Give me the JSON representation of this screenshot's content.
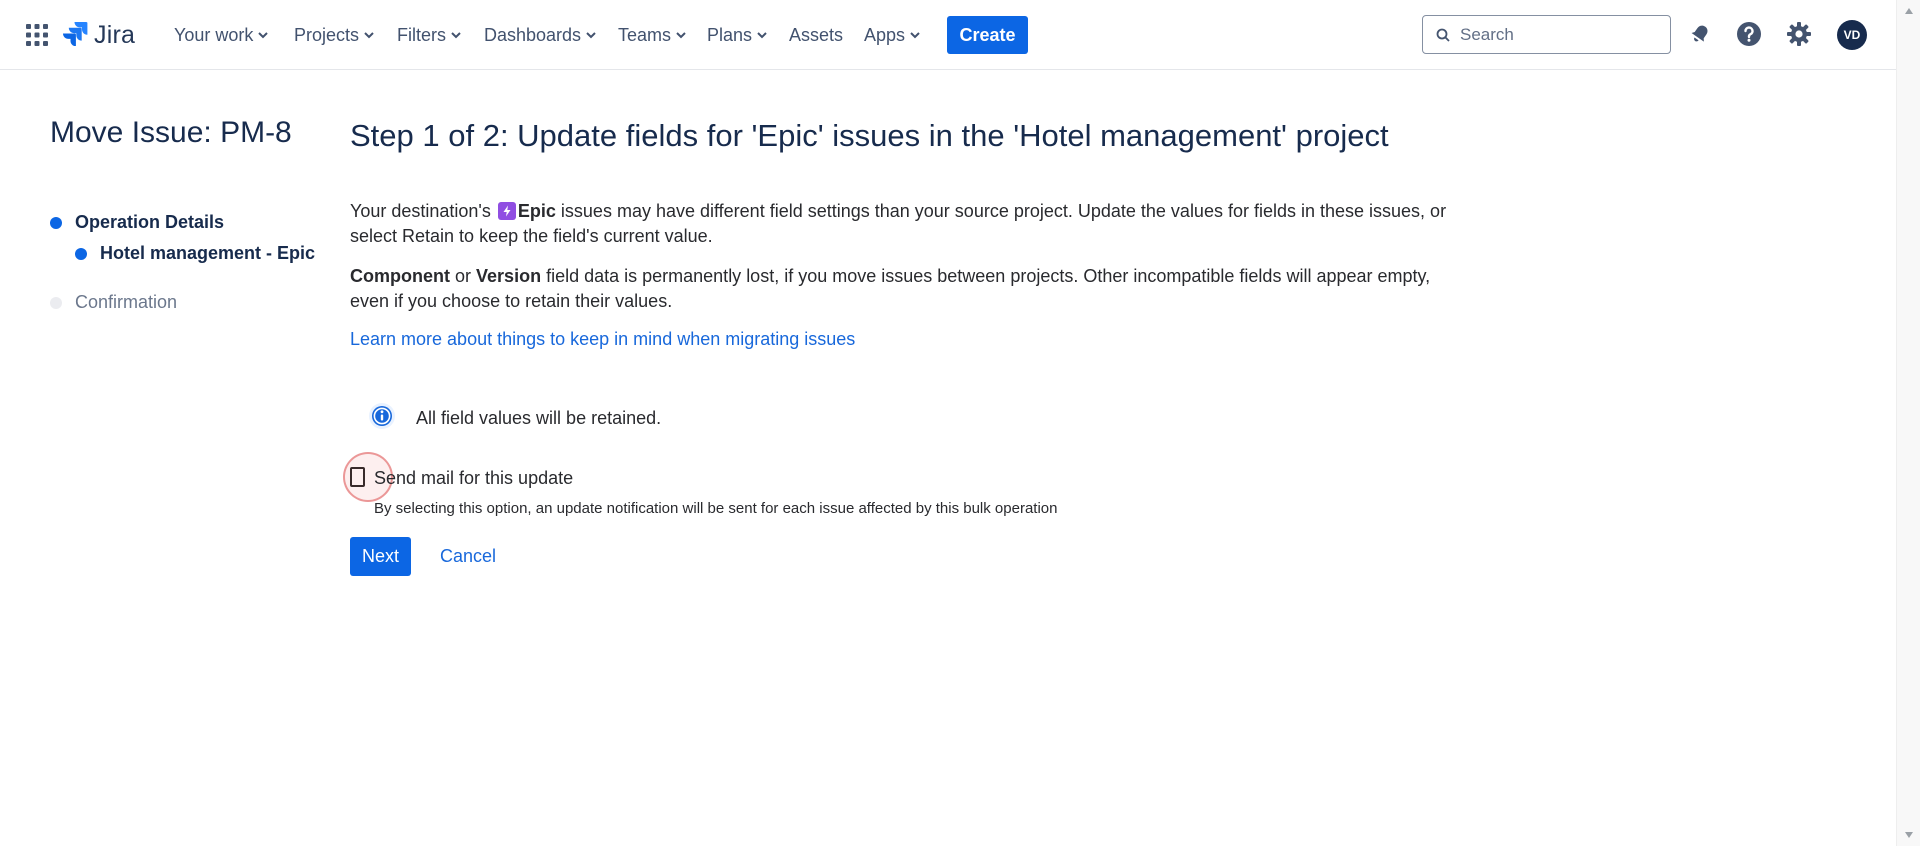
{
  "topnav": {
    "product": "Jira",
    "items": [
      {
        "label": "Your work",
        "dropdown": true
      },
      {
        "label": "Projects",
        "dropdown": true
      },
      {
        "label": "Filters",
        "dropdown": true
      },
      {
        "label": "Dashboards",
        "dropdown": true
      },
      {
        "label": "Teams",
        "dropdown": true
      },
      {
        "label": "Plans",
        "dropdown": true
      },
      {
        "label": "Assets",
        "dropdown": false
      },
      {
        "label": "Apps",
        "dropdown": true
      }
    ],
    "create_label": "Create",
    "search_placeholder": "Search",
    "avatar_initials": "VD",
    "icons": [
      "app-switcher-icon",
      "jira-logo-icon",
      "search-icon",
      "notifications-icon",
      "help-icon",
      "settings-icon"
    ]
  },
  "sidebar": {
    "heading": "Move Issue: PM-8",
    "steps": [
      {
        "label": "Operation Details",
        "state": "active"
      },
      {
        "label": "Hotel management - Epic",
        "state": "active"
      },
      {
        "label": "Confirmation",
        "state": "inactive"
      }
    ]
  },
  "main": {
    "title": "Step 1 of 2: Update fields for 'Epic' issues in the 'Hotel management' project",
    "para1_pre": "Your destination's",
    "para1_issue_type": "Epic",
    "para1_post": "issues may have different field settings than your source project. Update the values for fields in these issues, or select Retain to keep the field's current value.",
    "para2_component": "Component",
    "para2_or": "or",
    "para2_version": "Version",
    "para2_post": "field data is permanently lost, if you move issues between projects. Other incompatible fields will appear empty, even if you choose to retain their values.",
    "learn_link": "Learn more about things to keep in mind when migrating issues",
    "info_message": "All field values will be retained.",
    "send_mail": {
      "label": "Send mail for this update",
      "help": "By selecting this option, an update notification will be sent for each issue affected by this bulk operation",
      "checked": false
    },
    "next_label": "Next",
    "cancel_label": "Cancel"
  },
  "colors": {
    "primary": "#0c66e4",
    "link": "#1868db",
    "text": "#172b4d",
    "epic": "#904ee2",
    "step_inactive": "#ebecf0"
  }
}
